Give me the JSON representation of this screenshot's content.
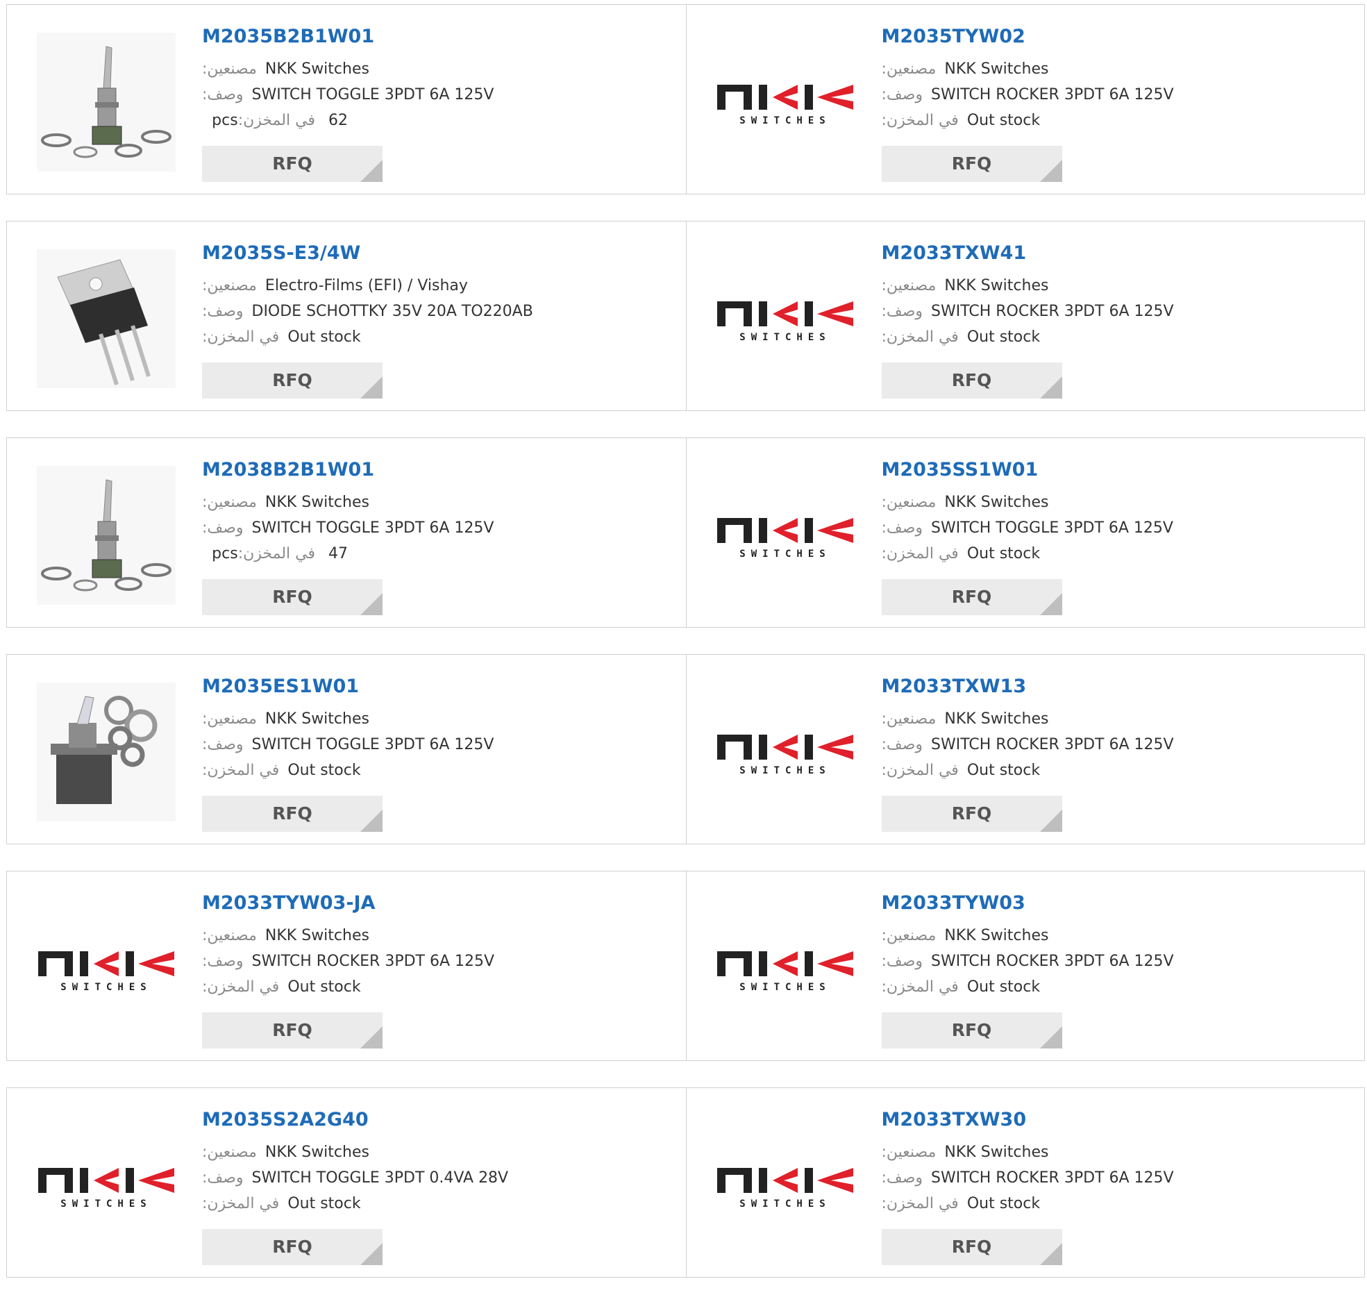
{
  "labels": {
    "manufacturer": ":مصنعين",
    "description": ":وصف",
    "stock": ":في المخزن",
    "stock_in": "في المخزن:",
    "pcs": "pcs",
    "rfq": "RFQ"
  },
  "logo": {
    "brand_top": "NKK",
    "brand_bottom": "SWITCHES"
  },
  "colors": {
    "link": "#1e6bb8",
    "logo_dark": "#222222",
    "logo_red": "#e0202a"
  },
  "products": [
    {
      "pn": "M2035B2B1W01",
      "manufacturer": "NKK Switches",
      "description": "SWITCH TOGGLE 3PDT 6A 125V",
      "stock": "62",
      "image": "toggle-switch-photo"
    },
    {
      "pn": "M2035TYW02",
      "manufacturer": "NKK Switches",
      "description": "SWITCH ROCKER 3PDT 6A 125V",
      "stock": "Out stock",
      "image": "nkk-logo"
    },
    {
      "pn": "M2035S-E3/4W",
      "manufacturer": "Electro-Films (EFI) / Vishay",
      "description": "DIODE SCHOTTKY 35V 20A TO220AB",
      "stock": "Out stock",
      "image": "to220-diode-photo"
    },
    {
      "pn": "M2033TXW41",
      "manufacturer": "NKK Switches",
      "description": "SWITCH ROCKER 3PDT 6A 125V",
      "stock": "Out stock",
      "image": "nkk-logo"
    },
    {
      "pn": "M2038B2B1W01",
      "manufacturer": "NKK Switches",
      "description": "SWITCH TOGGLE 3PDT 6A 125V",
      "stock": "47",
      "image": "toggle-switch-photo"
    },
    {
      "pn": "M2035SS1W01",
      "manufacturer": "NKK Switches",
      "description": "SWITCH TOGGLE 3PDT 6A 125V",
      "stock": "Out stock",
      "image": "nkk-logo"
    },
    {
      "pn": "M2035ES1W01",
      "manufacturer": "NKK Switches",
      "description": "SWITCH TOGGLE 3PDT 6A 125V",
      "stock": "Out stock",
      "image": "rotary-toggle-photo"
    },
    {
      "pn": "M2033TXW13",
      "manufacturer": "NKK Switches",
      "description": "SWITCH ROCKER 3PDT 6A 125V",
      "stock": "Out stock",
      "image": "nkk-logo"
    },
    {
      "pn": "M2033TYW03-JA",
      "manufacturer": "NKK Switches",
      "description": "SWITCH ROCKER 3PDT 6A 125V",
      "stock": "Out stock",
      "image": "nkk-logo"
    },
    {
      "pn": "M2033TYW03",
      "manufacturer": "NKK Switches",
      "description": "SWITCH ROCKER 3PDT 6A 125V",
      "stock": "Out stock",
      "image": "nkk-logo"
    },
    {
      "pn": "M2035S2A2G40",
      "manufacturer": "NKK Switches",
      "description": "SWITCH TOGGLE 3PDT 0.4VA 28V",
      "stock": "Out stock",
      "image": "nkk-logo"
    },
    {
      "pn": "M2033TXW30",
      "manufacturer": "NKK Switches",
      "description": "SWITCH ROCKER 3PDT 6A 125V",
      "stock": "Out stock",
      "image": "nkk-logo"
    }
  ]
}
